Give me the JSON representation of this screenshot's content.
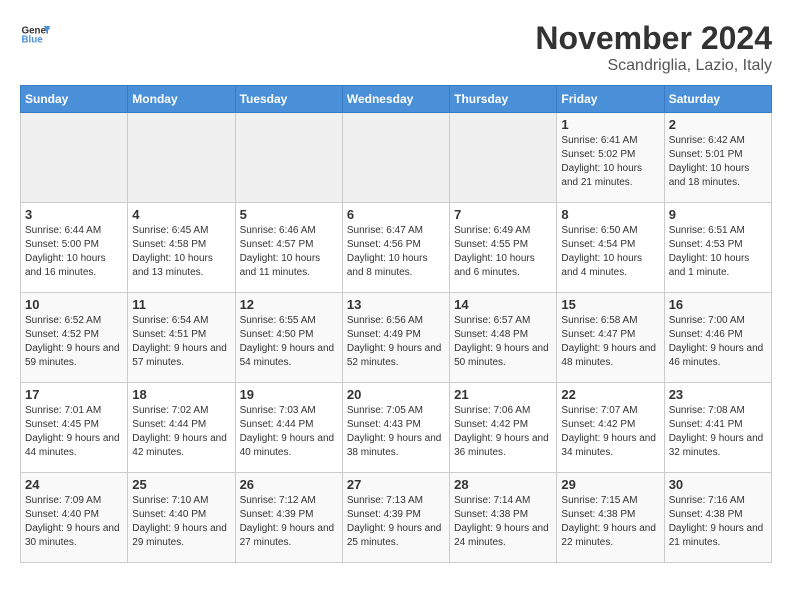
{
  "logo": {
    "text_general": "General",
    "text_blue": "Blue"
  },
  "title": "November 2024",
  "location": "Scandriglia, Lazio, Italy",
  "days_of_week": [
    "Sunday",
    "Monday",
    "Tuesday",
    "Wednesday",
    "Thursday",
    "Friday",
    "Saturday"
  ],
  "weeks": [
    [
      {
        "day": "",
        "empty": true
      },
      {
        "day": "",
        "empty": true
      },
      {
        "day": "",
        "empty": true
      },
      {
        "day": "",
        "empty": true
      },
      {
        "day": "",
        "empty": true
      },
      {
        "day": "1",
        "sunrise": "6:41 AM",
        "sunset": "5:02 PM",
        "daylight": "10 hours and 21 minutes."
      },
      {
        "day": "2",
        "sunrise": "6:42 AM",
        "sunset": "5:01 PM",
        "daylight": "10 hours and 18 minutes."
      }
    ],
    [
      {
        "day": "3",
        "sunrise": "6:44 AM",
        "sunset": "5:00 PM",
        "daylight": "10 hours and 16 minutes."
      },
      {
        "day": "4",
        "sunrise": "6:45 AM",
        "sunset": "4:58 PM",
        "daylight": "10 hours and 13 minutes."
      },
      {
        "day": "5",
        "sunrise": "6:46 AM",
        "sunset": "4:57 PM",
        "daylight": "10 hours and 11 minutes."
      },
      {
        "day": "6",
        "sunrise": "6:47 AM",
        "sunset": "4:56 PM",
        "daylight": "10 hours and 8 minutes."
      },
      {
        "day": "7",
        "sunrise": "6:49 AM",
        "sunset": "4:55 PM",
        "daylight": "10 hours and 6 minutes."
      },
      {
        "day": "8",
        "sunrise": "6:50 AM",
        "sunset": "4:54 PM",
        "daylight": "10 hours and 4 minutes."
      },
      {
        "day": "9",
        "sunrise": "6:51 AM",
        "sunset": "4:53 PM",
        "daylight": "10 hours and 1 minute."
      }
    ],
    [
      {
        "day": "10",
        "sunrise": "6:52 AM",
        "sunset": "4:52 PM",
        "daylight": "9 hours and 59 minutes."
      },
      {
        "day": "11",
        "sunrise": "6:54 AM",
        "sunset": "4:51 PM",
        "daylight": "9 hours and 57 minutes."
      },
      {
        "day": "12",
        "sunrise": "6:55 AM",
        "sunset": "4:50 PM",
        "daylight": "9 hours and 54 minutes."
      },
      {
        "day": "13",
        "sunrise": "6:56 AM",
        "sunset": "4:49 PM",
        "daylight": "9 hours and 52 minutes."
      },
      {
        "day": "14",
        "sunrise": "6:57 AM",
        "sunset": "4:48 PM",
        "daylight": "9 hours and 50 minutes."
      },
      {
        "day": "15",
        "sunrise": "6:58 AM",
        "sunset": "4:47 PM",
        "daylight": "9 hours and 48 minutes."
      },
      {
        "day": "16",
        "sunrise": "7:00 AM",
        "sunset": "4:46 PM",
        "daylight": "9 hours and 46 minutes."
      }
    ],
    [
      {
        "day": "17",
        "sunrise": "7:01 AM",
        "sunset": "4:45 PM",
        "daylight": "9 hours and 44 minutes."
      },
      {
        "day": "18",
        "sunrise": "7:02 AM",
        "sunset": "4:44 PM",
        "daylight": "9 hours and 42 minutes."
      },
      {
        "day": "19",
        "sunrise": "7:03 AM",
        "sunset": "4:44 PM",
        "daylight": "9 hours and 40 minutes."
      },
      {
        "day": "20",
        "sunrise": "7:05 AM",
        "sunset": "4:43 PM",
        "daylight": "9 hours and 38 minutes."
      },
      {
        "day": "21",
        "sunrise": "7:06 AM",
        "sunset": "4:42 PM",
        "daylight": "9 hours and 36 minutes."
      },
      {
        "day": "22",
        "sunrise": "7:07 AM",
        "sunset": "4:42 PM",
        "daylight": "9 hours and 34 minutes."
      },
      {
        "day": "23",
        "sunrise": "7:08 AM",
        "sunset": "4:41 PM",
        "daylight": "9 hours and 32 minutes."
      }
    ],
    [
      {
        "day": "24",
        "sunrise": "7:09 AM",
        "sunset": "4:40 PM",
        "daylight": "9 hours and 30 minutes."
      },
      {
        "day": "25",
        "sunrise": "7:10 AM",
        "sunset": "4:40 PM",
        "daylight": "9 hours and 29 minutes."
      },
      {
        "day": "26",
        "sunrise": "7:12 AM",
        "sunset": "4:39 PM",
        "daylight": "9 hours and 27 minutes."
      },
      {
        "day": "27",
        "sunrise": "7:13 AM",
        "sunset": "4:39 PM",
        "daylight": "9 hours and 25 minutes."
      },
      {
        "day": "28",
        "sunrise": "7:14 AM",
        "sunset": "4:38 PM",
        "daylight": "9 hours and 24 minutes."
      },
      {
        "day": "29",
        "sunrise": "7:15 AM",
        "sunset": "4:38 PM",
        "daylight": "9 hours and 22 minutes."
      },
      {
        "day": "30",
        "sunrise": "7:16 AM",
        "sunset": "4:38 PM",
        "daylight": "9 hours and 21 minutes."
      }
    ]
  ]
}
